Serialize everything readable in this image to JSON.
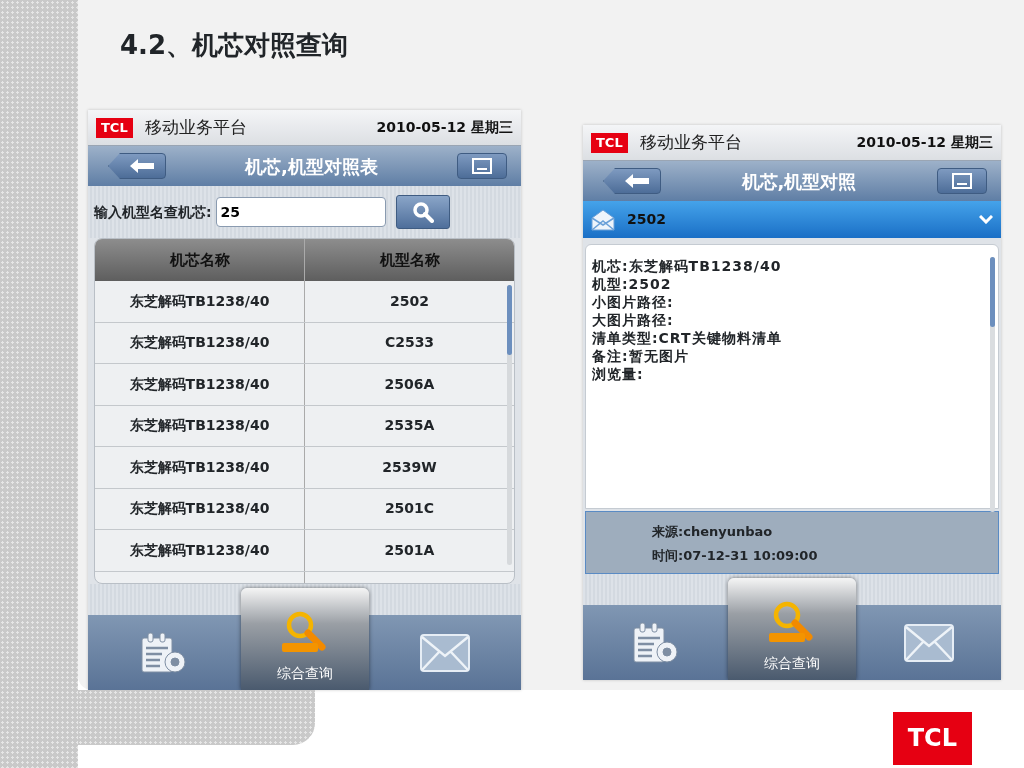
{
  "slide": {
    "title": "4.2、机芯对照查询"
  },
  "phones": [
    {
      "kind": "list",
      "header": {
        "logo": "TCL",
        "app": "移动业务平台",
        "date": "2010-05-12 星期三"
      },
      "nav": {
        "title": "机芯,机型对照表"
      },
      "search": {
        "label": "输入机型名查机芯:",
        "value": "25"
      },
      "table": {
        "columns": [
          "机芯名称",
          "机型名称"
        ],
        "rows": [
          [
            "东芝解码TB1238/40",
            "2502"
          ],
          [
            "东芝解码TB1238/40",
            "C2533"
          ],
          [
            "东芝解码TB1238/40",
            "2506A"
          ],
          [
            "东芝解码TB1238/40",
            "2535A"
          ],
          [
            "东芝解码TB1238/40",
            "2539W"
          ],
          [
            "东芝解码TB1238/40",
            "2501C"
          ],
          [
            "东芝解码TB1238/40",
            "2501A"
          ]
        ]
      },
      "tabs": [
        {
          "selected": false
        },
        {
          "label": "综合查询",
          "selected": true
        },
        {
          "selected": false
        }
      ]
    },
    {
      "kind": "detail",
      "header": {
        "logo": "TCL",
        "app": "移动业务平台",
        "date": "2010-05-12 星期三"
      },
      "nav": {
        "title": "机芯,机型对照"
      },
      "message": {
        "title": "2502"
      },
      "details": [
        "机芯:东芝解码TB1238/40",
        "机型:2502",
        "小图片路径:",
        "大图片路径:",
        "清单类型:CRT关键物料清单",
        "备注:暂无图片",
        "浏览量:"
      ],
      "source": "来源:chenyunbao",
      "time": "时间:07-12-31 10:09:00",
      "tabs": [
        {
          "selected": false
        },
        {
          "label": "综合查询",
          "selected": true
        },
        {
          "selected": false
        }
      ]
    }
  ],
  "footer": {
    "logo": "TCL"
  }
}
